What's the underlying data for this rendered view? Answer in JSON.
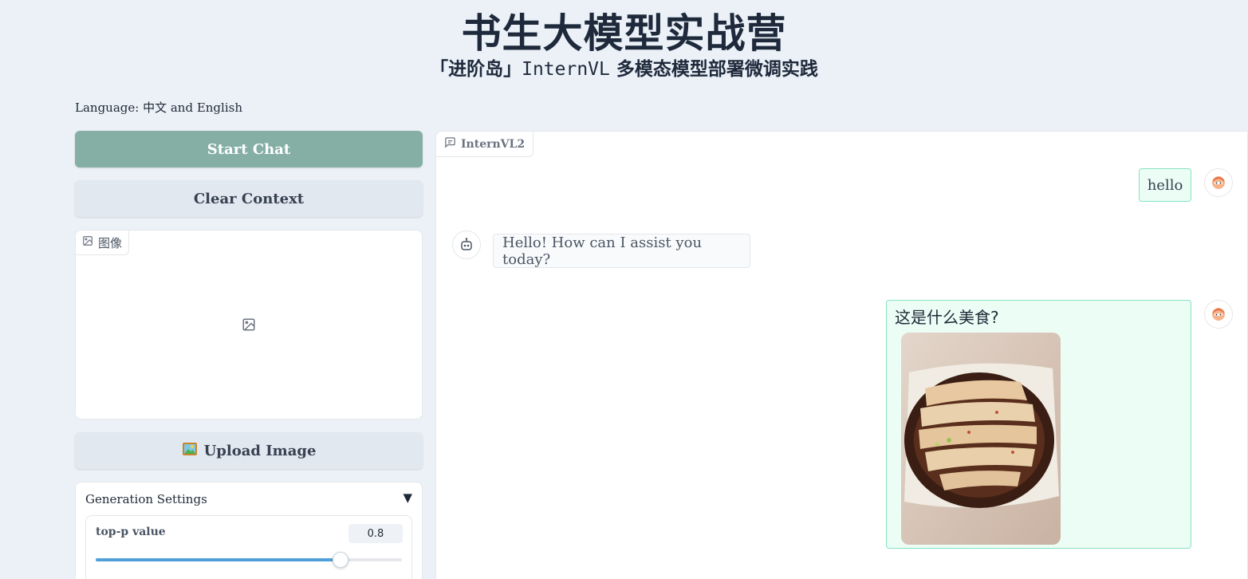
{
  "header": {
    "title": "书生大模型实战营",
    "subtitle_prefix": "「进阶岛」",
    "subtitle_mono": "InternVL",
    "subtitle_suffix": "多模态模型部署微调实践"
  },
  "language_note": "Language: 中文 and English",
  "buttons": {
    "start_chat": "Start Chat",
    "clear_context": "Clear Context",
    "upload_image": "Upload Image"
  },
  "image_panel": {
    "label": "图像"
  },
  "settings": {
    "title": "Generation Settings",
    "toggle_icon": "▼",
    "top_p": {
      "label": "top-p value",
      "value": "0.8",
      "fraction": 0.8
    }
  },
  "chatbot": {
    "label": "InternVL2",
    "messages": [
      {
        "role": "user",
        "text": "hello"
      },
      {
        "role": "assistant",
        "text": "Hello! How can I assist you today?"
      },
      {
        "role": "user",
        "text": "这是什么美食?",
        "has_image": true
      }
    ]
  },
  "icons": {
    "image_label": "image-icon",
    "chat_label": "chat-bubble-icon",
    "user_avatar": "user-avatar-icon",
    "bot_avatar": "robot-avatar-icon",
    "upload": "framed-picture-emoji"
  },
  "colors": {
    "page_bg": "#ebf1f7",
    "primary_button": "#85afa5",
    "secondary_button": "#e2e8f0",
    "user_bubble_bg": "#ecfdf5",
    "user_bubble_border": "#86e3c2",
    "slider_fill": "#4f9fd9"
  }
}
